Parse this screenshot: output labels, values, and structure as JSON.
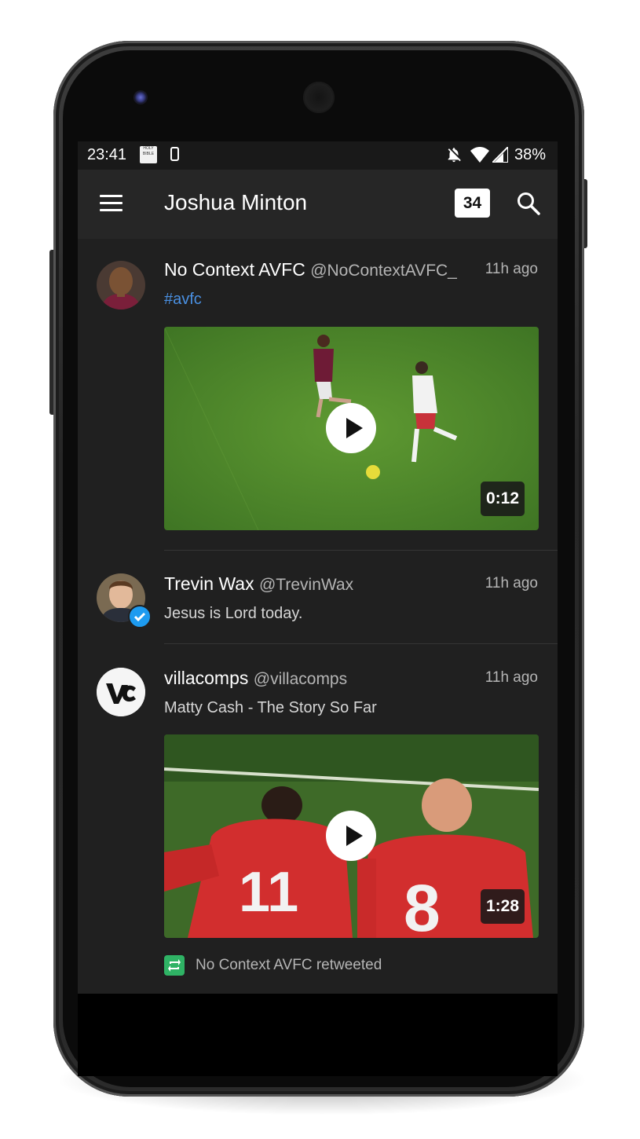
{
  "status_bar": {
    "time": "23:41",
    "battery": "38%",
    "bible_icon_text": "HOLY BIBLE"
  },
  "app_bar": {
    "title": "Joshua Minton",
    "unread_count": "34"
  },
  "tweets": [
    {
      "name": "No Context AVFC",
      "handle": "@NoContextAVFC_",
      "time": "11h ago",
      "text": "#avfc",
      "media": {
        "type": "video",
        "duration": "0:12"
      }
    },
    {
      "name": "Trevin Wax",
      "handle": "@TrevinWax",
      "time": "11h ago",
      "text": "Jesus is Lord today.",
      "verified": true
    },
    {
      "name": "villacomps",
      "handle": "@villacomps",
      "time": "11h ago",
      "text": "Matty Cash - The Story So Far",
      "media": {
        "type": "video",
        "duration": "1:28"
      },
      "retweeted_by": "No Context AVFC retweeted"
    }
  ],
  "colors": {
    "background": "#202020",
    "app_bar": "#262626",
    "hashtag": "#4a90e2",
    "retweet": "#2fb365",
    "verified": "#1d9bf0"
  },
  "icons": [
    "menu-icon",
    "search-icon",
    "play-icon",
    "retweet-icon",
    "verified-icon",
    "wifi-icon",
    "signal-icon",
    "notifications-off-icon"
  ]
}
